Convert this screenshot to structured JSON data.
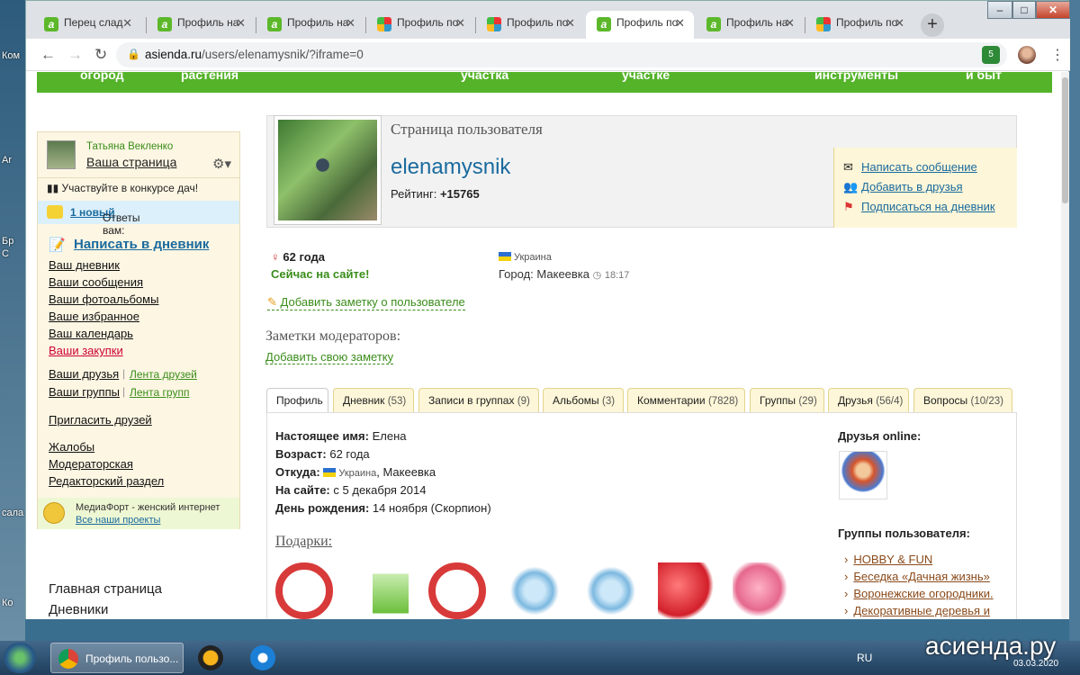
{
  "desktop": {
    "left_labels": [
      "Ком",
      "Ar",
      "Бр",
      "С",
      "сала",
      "Ко"
    ]
  },
  "browser": {
    "tabs": [
      {
        "label": "Перец слад",
        "icon": "asienda-favicon"
      },
      {
        "label": "Профиль на",
        "icon": "asienda-favicon"
      },
      {
        "label": "Профиль на",
        "icon": "asienda-favicon"
      },
      {
        "label": "Профиль по",
        "icon": "mosaic-favicon"
      },
      {
        "label": "Профиль по",
        "icon": "mosaic-favicon"
      },
      {
        "label": "Профиль по",
        "icon": "asienda-favicon",
        "active": true
      },
      {
        "label": "Профиль на",
        "icon": "asienda-favicon"
      },
      {
        "label": "Профиль по",
        "icon": "mosaic-favicon"
      }
    ],
    "tab_close": "✕",
    "new_tab": "+",
    "url_domain": "asienda.ru",
    "url_path": "/users/elenamysnik/?iframe=0",
    "ext_badge": "5",
    "window_buttons": {
      "min": "–",
      "max": "□",
      "close": "✕"
    }
  },
  "topnav": {
    "items": [
      "огород",
      "растения",
      "участка",
      "участке",
      "инструменты",
      "и быт"
    ]
  },
  "sidebar": {
    "user_name": "Татьяна Векленко",
    "your_page": "Ваша страница",
    "contest": "Участвуйте в конкурсе дач!",
    "answers_label": "Ответы вам:",
    "answers_link": "1 новый",
    "write_diary": "Написать в дневник",
    "links": [
      "Ваш дневник",
      "Ваши сообщения",
      "Ваши фотоальбомы",
      "Ваше избранное",
      "Ваш календарь",
      "Ваши закупки"
    ],
    "friends": "Ваши друзья",
    "friends_feed": "Лента друзей",
    "groups": "Ваши группы",
    "groups_feed": "Лента групп",
    "invite": "Пригласить друзей",
    "complaints": "Жалобы",
    "moderator": "Модераторская",
    "editor": "Редакторский раздел",
    "mediafort_title": "МедиаФорт - женский интернет",
    "mediafort_link": "Все наши проекты",
    "bottom_links": [
      "Главная страница",
      "Дневники"
    ]
  },
  "profile": {
    "section_title": "Страница пользователя",
    "nickname": "elenamysnik",
    "rating_label": "Рейтинг:",
    "rating_value": "+15765",
    "actions": [
      "Написать сообщение",
      "Добавить в друзья",
      "Подписаться на дневник"
    ],
    "age": "62 года",
    "online": "Сейчас на сайте!",
    "country": "Украина",
    "city_label": "Город:",
    "city": "Макеевка",
    "local_time": "18:17",
    "add_note": "Добавить заметку о пользователе",
    "mod_notes": "Заметки модераторов:",
    "add_my_note": "Добавить свою заметку"
  },
  "profile_tabs": [
    {
      "label": "Профиль",
      "count": ""
    },
    {
      "label": "Дневник",
      "count": "(53)"
    },
    {
      "label": "Записи в группах",
      "count": "(9)"
    },
    {
      "label": "Альбомы",
      "count": "(3)"
    },
    {
      "label": "Комментарии",
      "count": "(7828)"
    },
    {
      "label": "Группы",
      "count": "(29)"
    },
    {
      "label": "Друзья",
      "count": "(56/4)"
    },
    {
      "label": "Вопросы",
      "count": "(10/23)"
    }
  ],
  "details": {
    "real_name_label": "Настоящее имя:",
    "real_name": "Елена",
    "age_label": "Возраст:",
    "age": "62 года",
    "from_label": "Откуда:",
    "from_country": "Украина",
    "from_city": ", Макеевка",
    "since_label": "На сайте:",
    "since": "с 5 декабря 2014",
    "birthday_label": "День рождения:",
    "birthday": "14 ноября (Скорпион)",
    "gifts_title": "Подарки"
  },
  "right_col": {
    "friends_online": "Друзья online:",
    "groups_title": "Группы пользователя:",
    "groups": [
      "HOBBY & FUN",
      "Беседка «Дачная жизнь»",
      "Воронежские огородники.",
      "Декоративные деревья и"
    ]
  },
  "taskbar": {
    "item_label": "Профиль пользо...",
    "lang": "RU",
    "watermark": "асиенда.ру",
    "date": "03.03.2020"
  }
}
